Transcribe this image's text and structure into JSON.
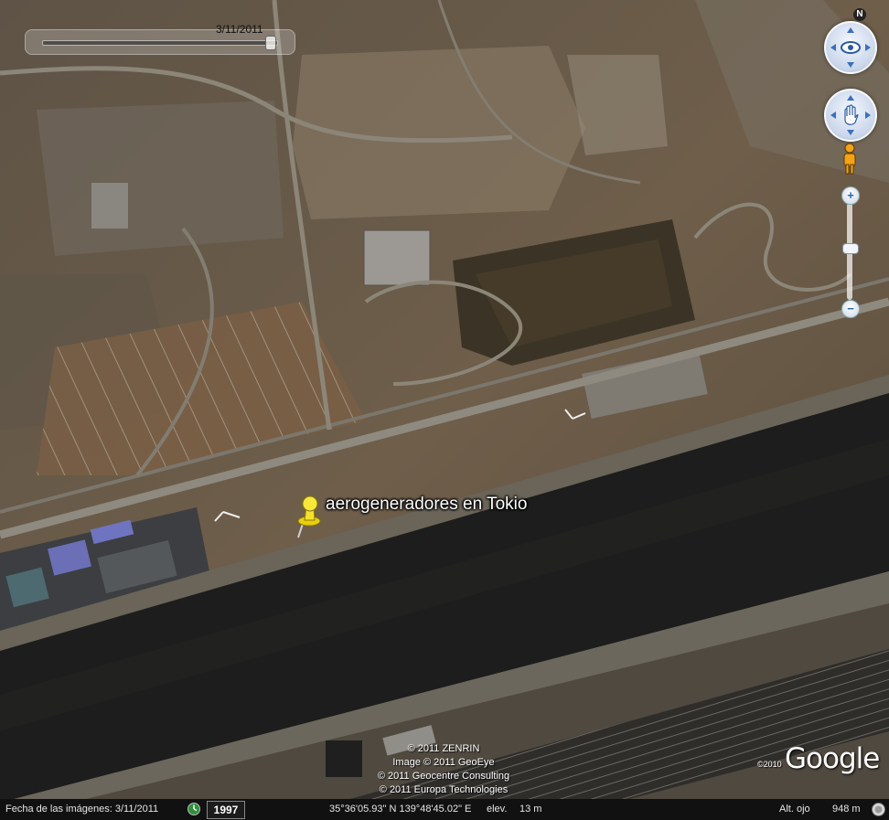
{
  "time_slider": {
    "date": "3/11/2011"
  },
  "navigation": {
    "north_label": "N",
    "look_icon": "eye-icon",
    "move_icon": "hand-icon",
    "street_view_icon": "pegman-icon",
    "zoom_in_label": "+",
    "zoom_out_label": "−"
  },
  "placemark": {
    "icon": "yellow-pushpin-icon",
    "label": "aerogeneradores en Tokio"
  },
  "attribution": {
    "lines": [
      "© 2011 ZENRIN",
      "Image © 2011 GeoEye",
      "© 2011 Geocentre Consulting",
      "© 2011 Europa Technologies"
    ],
    "logo_copyright": "©2010",
    "logo_text": "Google"
  },
  "status_bar": {
    "imagery_date": "Fecha de las imágenes: 3/11/2011",
    "history_year": "1997",
    "coordinates": "35°36'05.93\" N 139°48'45.02\" E",
    "elevation_label": "elev.",
    "elevation_value": "13 m",
    "eye_altitude_label": "Alt. ojo",
    "eye_altitude_value": "948 m"
  },
  "colors": {
    "water": "#1a1b1a",
    "land": "#6b5b47",
    "roads": "#9a958c",
    "pin": "#f5e12a"
  }
}
